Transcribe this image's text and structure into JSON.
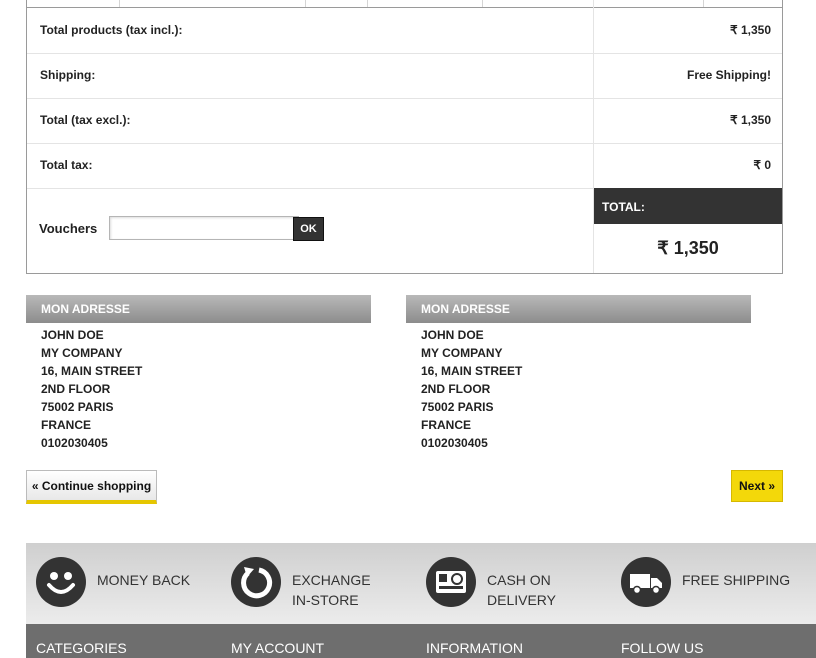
{
  "summary": {
    "rows": [
      {
        "label": "Total products (tax incl.):",
        "value": "₹ 1,350"
      },
      {
        "label": "Shipping:",
        "value": "Free Shipping!"
      },
      {
        "label": "Total (tax excl.):",
        "value": "₹ 1,350"
      },
      {
        "label": "Total tax:",
        "value": "₹ 0"
      }
    ],
    "vouchers_label": "Vouchers",
    "voucher_input_value": "",
    "ok_label": "OK",
    "total_label": "TOTAL:",
    "total_value": "₹ 1,350"
  },
  "addresses": [
    {
      "title": "MON ADRESSE",
      "lines": [
        "JOHN DOE",
        "MY COMPANY",
        "16, MAIN STREET",
        "2ND FLOOR",
        "75002 PARIS",
        "FRANCE",
        "0102030405"
      ]
    },
    {
      "title": "MON ADRESSE",
      "lines": [
        "JOHN DOE",
        "MY COMPANY",
        "16, MAIN STREET",
        "2ND FLOOR",
        "75002 PARIS",
        "FRANCE",
        "0102030405"
      ]
    }
  ],
  "buttons": {
    "continue": "« Continue shopping",
    "next": "Next »"
  },
  "features": [
    {
      "icon": "smiley-icon",
      "line1": "MONEY BACK",
      "line2": ""
    },
    {
      "icon": "refresh-icon",
      "line1": "EXCHANGE",
      "line2": "IN-STORE"
    },
    {
      "icon": "card-icon",
      "line1": "CASH ON",
      "line2": "DELIVERY"
    },
    {
      "icon": "truck-icon",
      "line1": "FREE SHIPPING",
      "line2": ""
    }
  ],
  "footer": {
    "headings": [
      "CATEGORIES",
      "MY ACCOUNT",
      "INFORMATION",
      "FOLLOW US"
    ]
  },
  "colors": {
    "accent": "#f3d80a",
    "dark": "#333333",
    "header_gray": "#9e9e9e"
  }
}
